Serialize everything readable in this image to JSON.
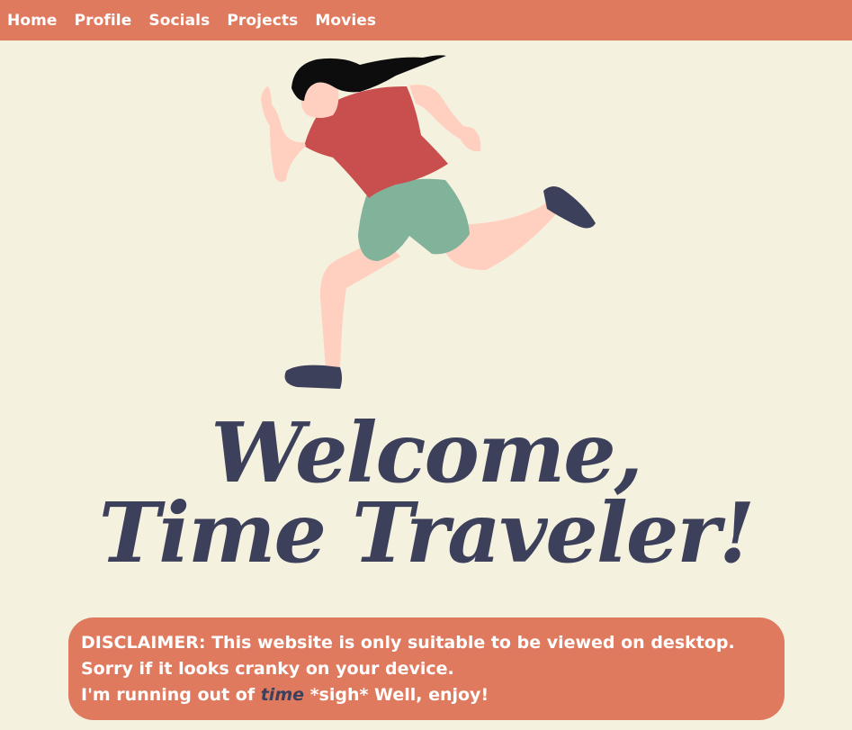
{
  "nav": {
    "items": [
      {
        "label": "Home"
      },
      {
        "label": "Profile"
      },
      {
        "label": "Socials"
      },
      {
        "label": "Projects"
      },
      {
        "label": "Movies"
      }
    ]
  },
  "hero": {
    "illustration": "running-woman-illustration"
  },
  "title": {
    "line1": "Welcome,",
    "line2": "Time Traveler!"
  },
  "disclaimer": {
    "line1": "DISCLAIMER: This website is only suitable to be viewed on desktop.",
    "line2": "Sorry if it looks cranky on your device.",
    "line3_before": "I'm running out of ",
    "line3_emph": "time",
    "line3_after": " *sigh* Well, enjoy!"
  },
  "colors": {
    "background": "#f5f1df",
    "accent": "#e07a5f",
    "title": "#3d405b"
  }
}
